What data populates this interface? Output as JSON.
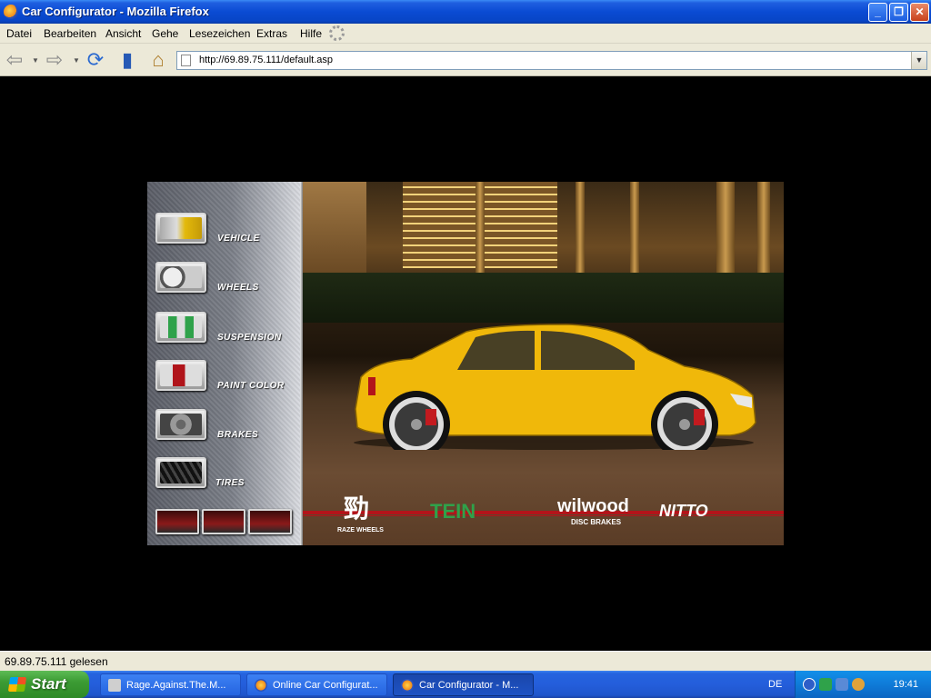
{
  "window": {
    "title": "Car Configurator - Mozilla Firefox",
    "buttons": [
      "_",
      "❐",
      "✕"
    ]
  },
  "menubar": {
    "items": [
      "Datei",
      "Bearbeiten",
      "Ansicht",
      "Gehe",
      "Lesezeichen",
      "Extras",
      "Hilfe"
    ]
  },
  "toolbar": {
    "url": "http://69.89.75.111/default.asp",
    "icons": [
      "back-arrow-icon",
      "forward-arrow-icon",
      "reload-icon",
      "bookmarks-icon",
      "home-icon"
    ]
  },
  "configurator": {
    "menu": [
      {
        "label": "VEHICLE",
        "icon": "vehicle-thumb"
      },
      {
        "label": "WHEELS",
        "icon": "wheels-thumb"
      },
      {
        "label": "SUSPENSION",
        "icon": "suspension-thumb"
      },
      {
        "label": "PAINT COLOR",
        "icon": "paint-thumb"
      },
      {
        "label": "BRAKES",
        "icon": "brakes-thumb"
      },
      {
        "label": "TIRES",
        "icon": "tires-thumb"
      }
    ],
    "brands": {
      "rays_symbol": "勁",
      "rays": "RAZE WHEELS",
      "tein": "TEIN",
      "wilwood": "wilwood",
      "wilwood_sub": "DISC BRAKES",
      "nitto": "NITTO"
    },
    "colors": {
      "car": "#f0b80a",
      "stripe": "#b3141a"
    }
  },
  "statusbar": {
    "text": "69.89.75.111 gelesen"
  },
  "taskbar": {
    "start": "Start",
    "tasks": [
      {
        "label": "Rage.Against.The.M...",
        "active": false
      },
      {
        "label": "Online Car Configurat...",
        "active": false
      },
      {
        "label": "Car Configurator - M...",
        "active": true
      }
    ],
    "lang": "DE",
    "clock": "19:41"
  }
}
